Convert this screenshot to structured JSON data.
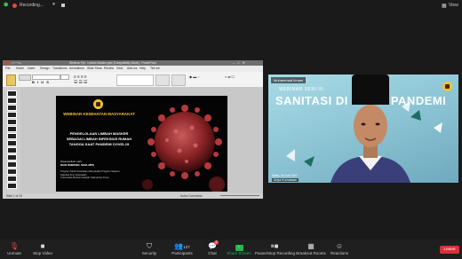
{
  "meeting": {
    "recording_label": "Recording...",
    "view_label": "View"
  },
  "ppt": {
    "title_text": "Webinar Ppt - Limbah Masker.pptx [Compatibility Mode] - PowerPoint",
    "menu": [
      "File",
      "Home",
      "Insert",
      "Design",
      "Transitions",
      "Animations",
      "Slide Show",
      "Review",
      "View",
      "Add-ins",
      "Help",
      "Tell me"
    ],
    "status_left": "Slide 1 of 25",
    "status_right": "Notes  Comments"
  },
  "slide": {
    "heading": "WEBINAR KESEHATAN MASYARAKAT",
    "title_lines": [
      "PENGELOLAAN LIMBAH MASKER",
      "SEBAGAI LIMBAH INFEKSIUS RUMAH",
      "TANGGA SAAT PANDEMI COVID-19"
    ],
    "presented_by": "Disampaikan oleh:",
    "presenter": "DIAN WIBOWO, SKM, MPH",
    "affiliation_lines": [
      "Program Studi Kesehatan Masyarakat Program Sarjana",
      "Fakultas Ilmu Kesehatan",
      "Universitas Muhammadiyah Kalimantan Timur"
    ]
  },
  "video": {
    "participant_name": "Muhammad Ilmam",
    "banner_small": "WEBINAR SERI III:",
    "banner_big": "SANITASI DI MASA PANDEMI",
    "date_text": "Sabtu, 06 Juni 2020",
    "name_label": "Ariya Kurniawan"
  },
  "toolbar": {
    "unmute": "Unmute",
    "stop_video": "Stop Video",
    "security": "Security",
    "participants": "Participants",
    "participants_count": "127",
    "chat": "Chat",
    "chat_badge": "2",
    "share_screen": "Share Screen",
    "pause_recording": "Pause/Stop Recording",
    "breakout_rooms": "Breakout Rooms",
    "reactions": "Reactions",
    "leave": "Leave"
  },
  "colors": {
    "share_green": "#1fb84f",
    "leave_red": "#d8323a",
    "recording_red": "#e5484d",
    "slide_yellow": "#f2c230",
    "video_teal": "#8ec7d8"
  }
}
